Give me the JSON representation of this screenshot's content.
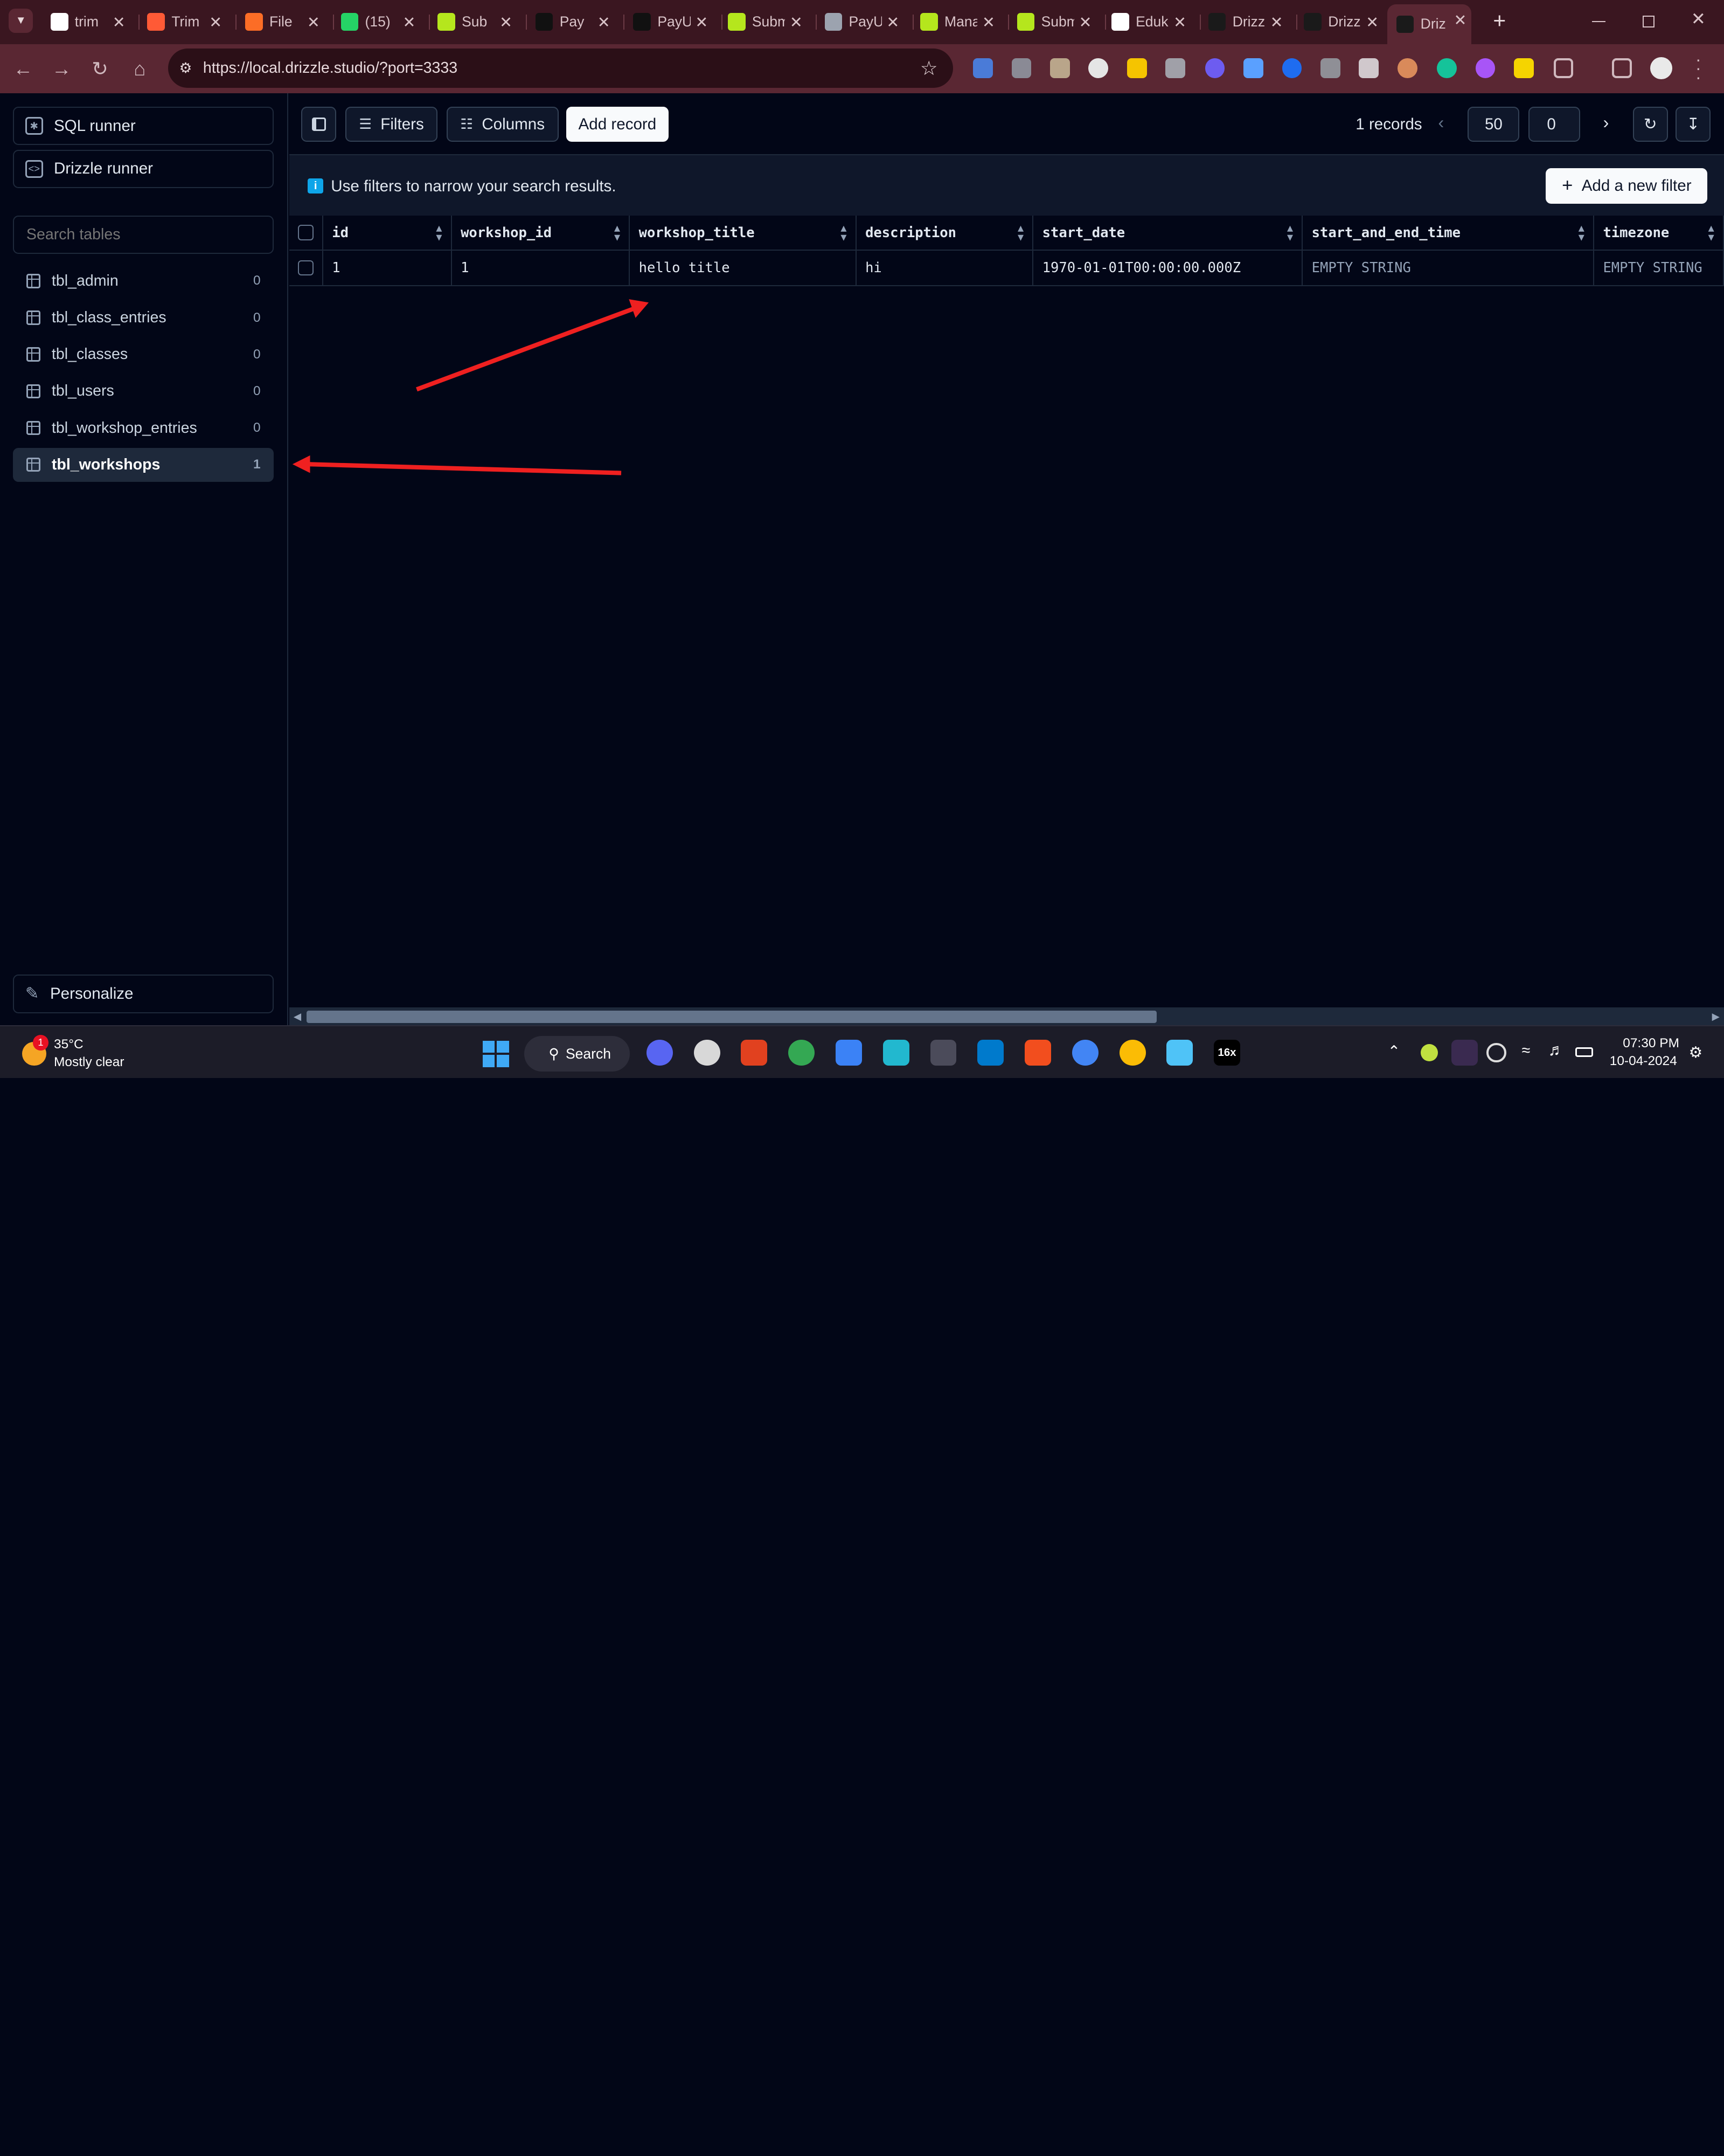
{
  "browser": {
    "tabs": [
      {
        "title": "trim",
        "fav": "#ffffff"
      },
      {
        "title": "Trim",
        "fav": "#ff5a36"
      },
      {
        "title": "File",
        "fav": "#fc6d26"
      },
      {
        "title": "(15)",
        "fav": "#25d366"
      },
      {
        "title": "Sub",
        "fav": "#b5e61d"
      },
      {
        "title": "Pay",
        "fav": "#111111"
      },
      {
        "title": "PayU Da",
        "fav": "#111111"
      },
      {
        "title": "Submit",
        "fav": "#b5e61d"
      },
      {
        "title": "PayU AP",
        "fav": "#9ca3af"
      },
      {
        "title": "Manage",
        "fav": "#b5e61d"
      },
      {
        "title": "Submit",
        "fav": "#b5e61d"
      },
      {
        "title": "Edukarn",
        "fav": "#ffffff"
      },
      {
        "title": "Drizzle",
        "fav": "#1a1a1a"
      },
      {
        "title": "Drizzle S",
        "fav": "#1a1a1a"
      },
      {
        "title": "Driz",
        "fav": "#1a1a1a"
      }
    ],
    "url": "https://local.drizzle.studio/?port=3333",
    "colors": {
      "frame": "#3a1620",
      "toolbar": "#5a2733",
      "accent": "#ef4444"
    }
  },
  "sidebar": {
    "sql_runner": "SQL runner",
    "drizzle_runner": "Drizzle runner",
    "search_placeholder": "Search tables",
    "tables": [
      {
        "name": "tbl_admin",
        "count": "0"
      },
      {
        "name": "tbl_class_entries",
        "count": "0"
      },
      {
        "name": "tbl_classes",
        "count": "0"
      },
      {
        "name": "tbl_users",
        "count": "0"
      },
      {
        "name": "tbl_workshop_entries",
        "count": "0"
      },
      {
        "name": "tbl_workshops",
        "count": "1"
      }
    ],
    "active_table": "tbl_workshops",
    "personalize": "Personalize"
  },
  "topbar": {
    "filters": "Filters",
    "columns": "Columns",
    "add_record": "Add record",
    "records": "1 records",
    "limit": "50",
    "offset": "0"
  },
  "info": {
    "message": "Use filters to narrow your search results.",
    "add_filter": "Add a new filter"
  },
  "table": {
    "columns": [
      "id",
      "workshop_id",
      "workshop_title",
      "description",
      "start_date",
      "start_and_end_time",
      "timezone"
    ],
    "rows": [
      [
        "1",
        "1",
        "hello title",
        "hi",
        "1970-01-01T00:00:00.000Z",
        "EMPTY STRING",
        "EMPTY STRING"
      ]
    ]
  },
  "taskbar": {
    "temperature": "35°C",
    "weather": "Mostly clear",
    "weather_badge": "1",
    "search": "Search",
    "time": "07:30 PM",
    "date": "10-04-2024",
    "app_16x": "16x"
  }
}
